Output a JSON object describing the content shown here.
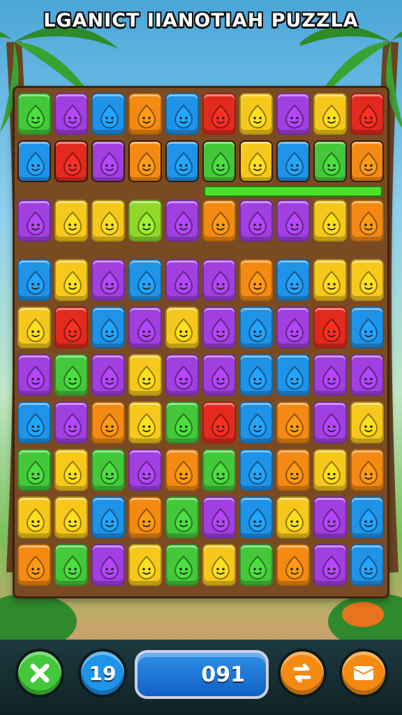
{
  "title": "LGANICT IIANOTIAH PUZZLA",
  "colors": {
    "G": "#43c83a",
    "P": "#a13fe0",
    "B": "#1f93e8",
    "O": "#f48a12",
    "R": "#e22a1e",
    "Y": "#f6c81c",
    "L": "#8fd82a",
    "K": "#e84fa8"
  },
  "board": {
    "rows": [
      [
        "G",
        "P",
        "B",
        "O",
        "B",
        "R",
        "Y",
        "P",
        "Y",
        "R"
      ],
      [
        "B",
        "R",
        "P",
        "O",
        "B",
        "G",
        "Y",
        "B",
        "G",
        "O"
      ],
      [
        "P",
        "Y",
        "Y",
        "L",
        "P",
        "O",
        "P",
        "P",
        "Y",
        "O"
      ],
      [
        "B",
        "Y",
        "P",
        "B",
        "P",
        "P",
        "O",
        "B",
        "Y",
        "Y"
      ],
      [
        "Y",
        "R",
        "B",
        "P",
        "Y",
        "P",
        "B",
        "P",
        "R",
        "B"
      ],
      [
        "P",
        "G",
        "P",
        "Y",
        "P",
        "P",
        "B",
        "B",
        "P",
        "P"
      ],
      [
        "B",
        "P",
        "O",
        "Y",
        "G",
        "R",
        "B",
        "O",
        "P",
        "Y"
      ],
      [
        "G",
        "Y",
        "G",
        "P",
        "O",
        "G",
        "B",
        "O",
        "Y",
        "O"
      ],
      [
        "Y",
        "Y",
        "B",
        "O",
        "G",
        "P",
        "B",
        "Y",
        "P",
        "B"
      ],
      [
        "O",
        "G",
        "P",
        "Y",
        "G",
        "Y",
        "G",
        "O",
        "P",
        "B"
      ]
    ],
    "selected_row": 1
  },
  "hud": {
    "close_icon": "close-x-icon",
    "moves": "19",
    "score": "091",
    "swap_icon": "swap-icon",
    "menu_icon": "menu-icon",
    "close_color": "#43c83a",
    "moves_color": "#1f93e8",
    "action_color": "#f48a12"
  }
}
